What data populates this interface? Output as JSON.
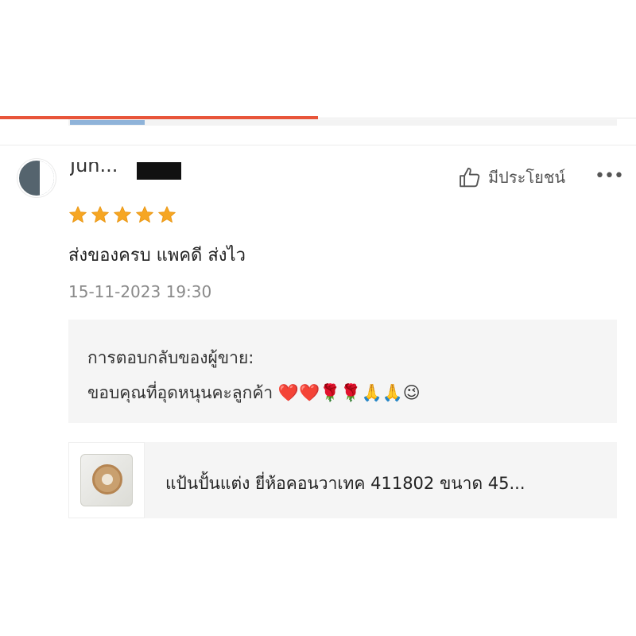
{
  "review": {
    "username": "Jun...",
    "rating": 5,
    "helpful_label": "มีประโยชน์",
    "more_label": "•••",
    "text": "ส่งของครบ แพคดี ส่งไว",
    "date": "15-11-2023 19:30"
  },
  "seller_reply": {
    "label": "การตอบกลับของผู้ขาย:",
    "text": "ขอบคุณที่อุดหนุนคะลูกค้า ❤️❤️🌹🌹🙏🙏😉"
  },
  "product": {
    "name": "แป้นปั้นแต่ง ยี่ห้อคอนวาเทค 411802 ขนาด 45..."
  },
  "colors": {
    "accent": "#e8553a",
    "star": "#f6a623",
    "panel": "#f5f5f5",
    "muted_text": "#8a8a8a"
  },
  "icons": {
    "helpful": "thumbs-up-icon",
    "more": "more-dots-icon",
    "star": "star-icon"
  }
}
